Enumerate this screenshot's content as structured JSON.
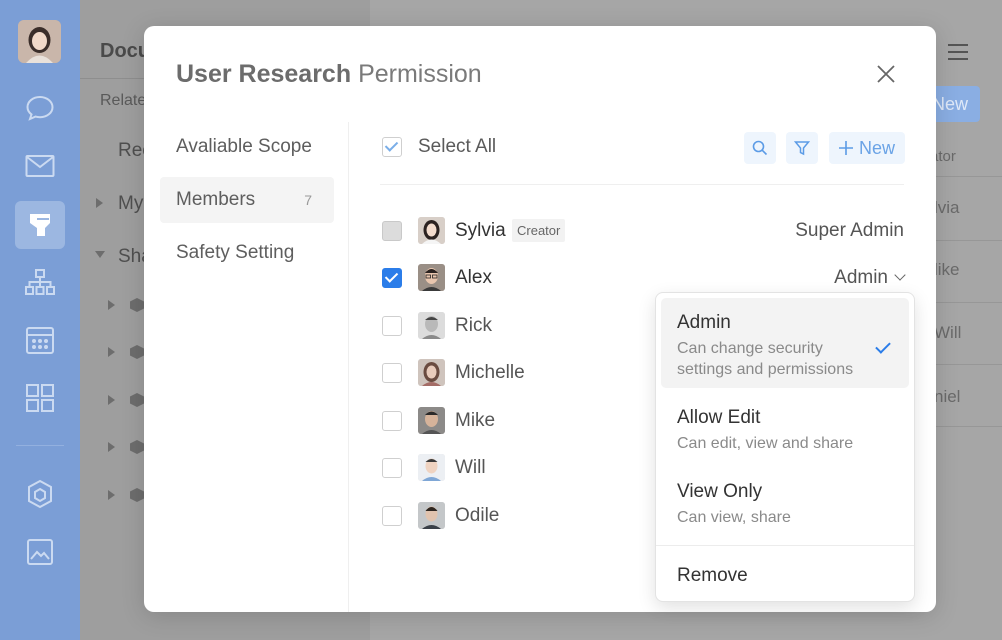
{
  "background": {
    "panel_title": "Docu",
    "related_label": "Relate",
    "tree": [
      "Rec",
      "My",
      "Sha"
    ],
    "new_button": "New",
    "column_header": "ator",
    "column_cells": [
      "lvia",
      "like",
      "Will",
      "niel"
    ]
  },
  "modal": {
    "title_bold": "User Research",
    "title_rest": " Permission",
    "nav": [
      {
        "label": "Avaliable Scope"
      },
      {
        "label": "Members",
        "count": "7"
      },
      {
        "label": "Safety Setting"
      }
    ],
    "select_all": "Select All",
    "new_button": "New",
    "members": [
      {
        "name": "Sylvia",
        "badge": "Creator",
        "role": "Super Admin",
        "state": "disabled"
      },
      {
        "name": "Alex",
        "role": "Admin",
        "state": "checked"
      },
      {
        "name": "Rick",
        "state": "unchecked"
      },
      {
        "name": "Michelle",
        "state": "unchecked"
      },
      {
        "name": "Mike",
        "state": "unchecked"
      },
      {
        "name": "Will",
        "state": "unchecked"
      },
      {
        "name": "Odile",
        "state": "unchecked"
      }
    ]
  },
  "dropdown": {
    "options": [
      {
        "title": "Admin",
        "desc": "Can change security settings and permissions",
        "selected": true
      },
      {
        "title": "Allow Edit",
        "desc": "Can edit, view and share"
      },
      {
        "title": "View Only",
        "desc": "Can view, share"
      }
    ],
    "remove": "Remove"
  },
  "colors": {
    "accent": "#2b7de9",
    "sidebar": "#7b9ed6",
    "tool_button_bg": "#eef5fd"
  },
  "icons": [
    "chat-icon",
    "mail-icon",
    "docs-icon",
    "org-chart-icon",
    "calendar-icon",
    "apps-icon",
    "cube-icon",
    "image-icon",
    "search-icon",
    "filter-icon",
    "plus-icon",
    "close-icon",
    "chevron-down-icon",
    "checkmark-icon"
  ]
}
